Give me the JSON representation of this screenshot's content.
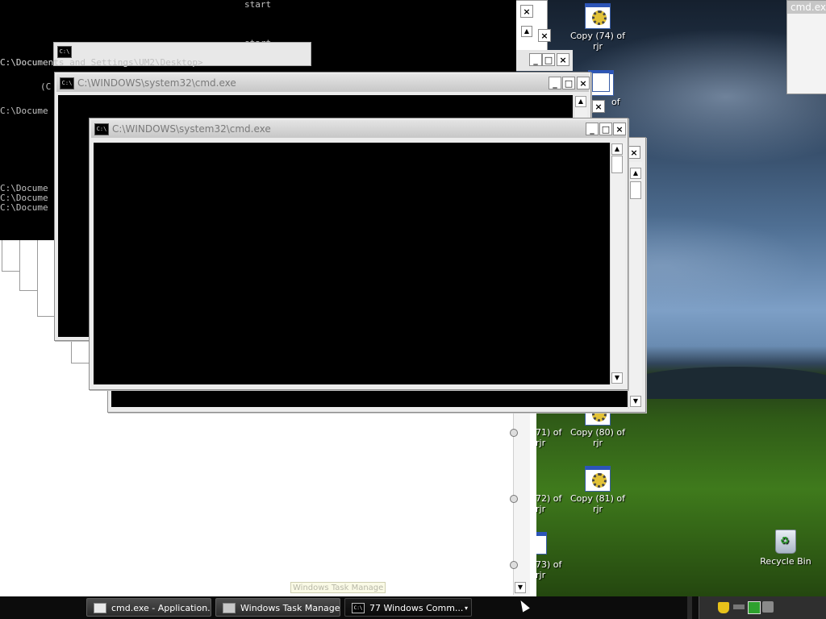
{
  "desktop": {
    "icons": [
      {
        "label": "Copy (74) of rjr",
        "icon": "program-icon"
      },
      {
        "label": "of",
        "icon": "program-icon"
      },
      {
        "label": "Copy (80) of rjr",
        "icon": "program-icon"
      },
      {
        "label": "Copy (81) of rjr",
        "icon": "program-icon"
      },
      {
        "label": "71) of rjr",
        "icon": "program-icon"
      },
      {
        "label": "72) of rjr",
        "icon": "program-icon"
      },
      {
        "label": "73) of rjr",
        "icon": "program-icon"
      }
    ],
    "recycle_bin": {
      "label": "Recycle Bin",
      "icon": "recycle-bin-icon"
    },
    "corner_window_title": "cmd.ex"
  },
  "background_console": {
    "lines": [
      "start",
      "start",
      "C:\\Documents and Settings\\UM2\\Desktop>",
      "(C",
      "C:\\Docume",
      "C:\\Docume",
      "C:\\Docume",
      "C:\\Docume"
    ]
  },
  "windows": {
    "middle": {
      "title": "C:\\WINDOWS\\system32\\cmd.exe",
      "icon_text": "C:\\"
    },
    "front": {
      "title": "C:\\WINDOWS\\system32\\cmd.exe",
      "icon_text": "C:\\"
    },
    "back_small_icon_text": "C:\\"
  },
  "title_buttons": {
    "minimize": "_",
    "maximize": "□",
    "close": "×"
  },
  "scroll_arrows": {
    "up": "▲",
    "down": "▼"
  },
  "taskbar": {
    "tasks": [
      {
        "label": "cmd.exe - Application...",
        "icon": "window-icon",
        "active": false
      },
      {
        "label": "Windows Task Manager",
        "icon": "task-manager-icon",
        "active": false
      },
      {
        "label": "77 Windows Comm...",
        "icon": "cmd-icon",
        "icon_text": "C:\\",
        "active": true
      }
    ],
    "group_arrow": "▾",
    "tray_icons": [
      "shield-icon",
      "network-icon",
      "monitor-icon",
      "speaker-icon"
    ]
  },
  "tooltip": "Windows Task Manage",
  "colors": {
    "console": "#000000",
    "title_inactive_text": "#7a7a7a",
    "taskbar": "#0c0c0c"
  }
}
